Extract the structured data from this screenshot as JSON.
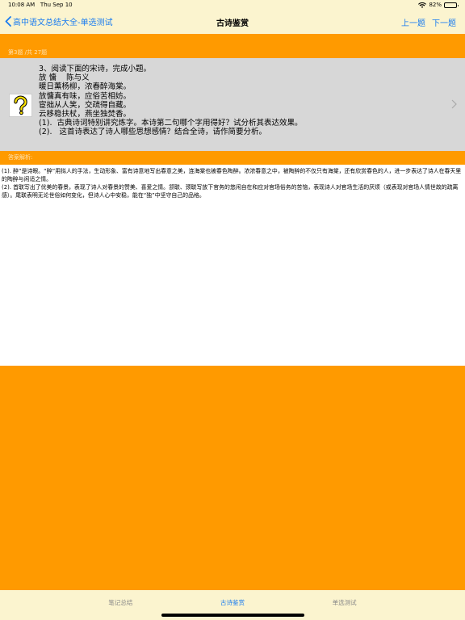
{
  "status": {
    "time": "10:08 AM",
    "date": "Thu Sep 10",
    "battery": "82%"
  },
  "nav": {
    "back_label": "高中语文总结大全-单选测试",
    "title": "古诗鉴赏",
    "prev_label": "上一题",
    "next_label": "下一题"
  },
  "question": {
    "counter": "第3题 /共 27题",
    "lines": [
      "3、阅读下面的宋诗，完成小题。",
      "放 慵    陈与义",
      "暖日薰杨柳，浓春醉海棠。",
      "放慵真有味，应俗苦相妨。",
      "宦拙从人笑，交疏得自藏。",
      "云移稳扶杖，燕坐独焚香。",
      "(1).  古典诗词特别讲究炼字。本诗第二句哪个字用得好？试分析其表达效果。",
      "(2).   这首诗表达了诗人哪些思想感情？结合全诗，请作简要分析。"
    ]
  },
  "answer": {
    "label": "答案解析:",
    "para1": "(1).  醉”是诗眼。“醉”用拟人的手法，生动形象、富有诗意地写出春意之美，连海棠也被春色陶醉。浓浓春意之中，被陶醉的不仅只有海棠，还有欣赏春色的人，进一步表达了诗人在春天里的陶醉与闲适之情。",
    "para2": "(2).   首联写出了优美的春景，表现了诗人对春景的赞美、喜爱之情。颔联、颈联写放下官务的悠闲自在和应对官场俗务的苦恼，表现诗人对官场生活的厌烦（或表现对官场人情世故的疏离感）。尾联表明无论世俗如何变化，但诗人心中安稳，能在“独”中坚守自己的品格。"
  },
  "tabs": [
    {
      "label": "笔记总结"
    },
    {
      "label": "古诗鉴赏"
    },
    {
      "label": "单选测试"
    }
  ],
  "colors": {
    "accent": "#1a7cf0",
    "orange": "#ff9a00",
    "bar_bg": "#fbf4cf",
    "card_bg": "#d7d7d7"
  }
}
